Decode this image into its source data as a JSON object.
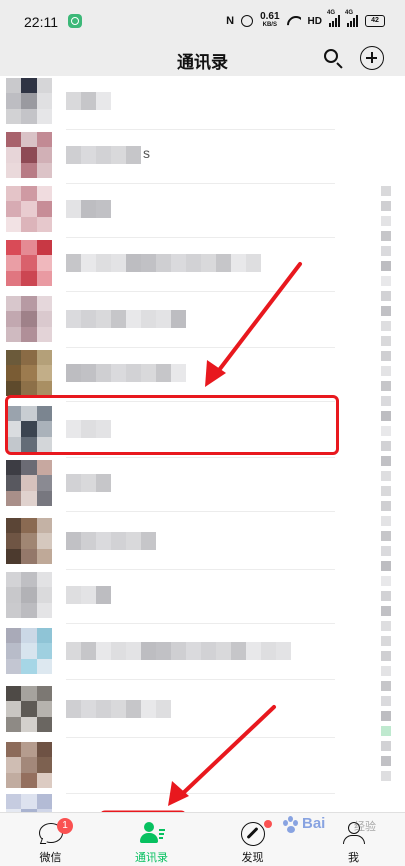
{
  "status_bar": {
    "time": "22:11",
    "nfc": "N",
    "net_speed_value": "0.61",
    "net_speed_unit": "KB/S",
    "hd": "HD",
    "signal_1": "4G",
    "signal_2": "4G",
    "battery": "42",
    "icons": [
      "app-icon",
      "nfc-icon",
      "alarm-icon",
      "wifi-icon",
      "signal-icon",
      "battery-icon"
    ]
  },
  "header": {
    "title": "通讯录",
    "icons": [
      "search-icon",
      "add-icon"
    ]
  },
  "contacts": {
    "visible_text": [
      "s"
    ]
  },
  "tabs": [
    {
      "label": "微信",
      "badge": "1",
      "icon": "chat-icon"
    },
    {
      "label": "通讯录",
      "icon": "contacts-icon",
      "active": true
    },
    {
      "label": "发现",
      "icon": "discover-icon",
      "dot": true
    },
    {
      "label": "我",
      "icon": "me-icon"
    }
  ],
  "watermark": {
    "text": "Bai",
    "suffix": "经验"
  },
  "colors": {
    "accent": "#07c160",
    "annotation": "#e8181e",
    "badge": "#fa5151"
  }
}
